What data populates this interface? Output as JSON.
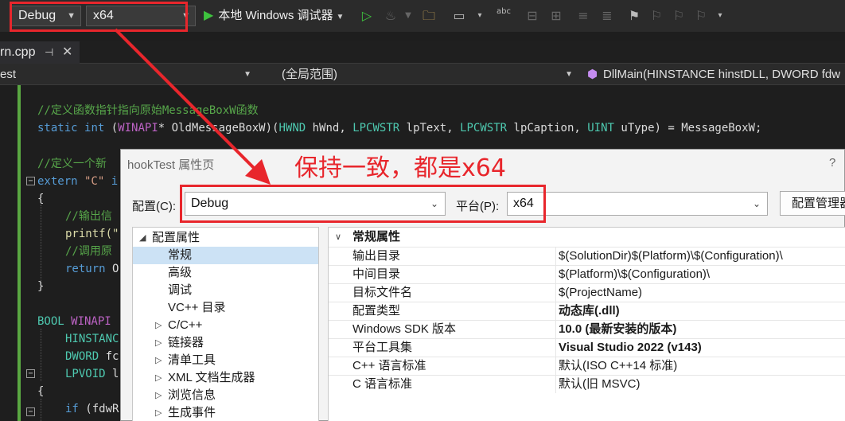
{
  "toolbar": {
    "config_value": "Debug",
    "platform_value": "x64",
    "run_label": "本地 Windows 调试器",
    "spell_icon_text": "abc"
  },
  "tabs": {
    "active_tab_label": "rn.cpp",
    "pin_glyph": "⊣",
    "close_glyph": "✕"
  },
  "navbar": {
    "project_value": "est",
    "scope_value": "(全局范围)",
    "member_value": "DllMain(HINSTANCE hinstDLL, DWORD fdw"
  },
  "code": {
    "line1_comment": "//定义函数指针指向原始MessageBoxW函数",
    "line2": {
      "kw_static": "static",
      "kw_int": "int",
      "p1": " (",
      "macro_winapi": "WINAPI",
      "p2": "* OldMessageBoxW)(",
      "t_hwnd": "HWND",
      "p3": " hWnd, ",
      "t_lpcwstr1": "LPCWSTR",
      "p4": " lpText, ",
      "t_lpcwstr2": "LPCWSTR",
      "p5": " lpCaption, ",
      "t_uint": "UINT",
      "p6": " uType) = MessageBoxW;"
    },
    "line4_comment": "//定义一个新",
    "line5": {
      "kw_extern": "extern",
      "str_c": " \"C\"",
      "rest": " i"
    },
    "line6": "{",
    "line7_comment": "//输出信",
    "line8": "printf(\"",
    "line9_comment": "//调用原",
    "line10": {
      "kw_return": "return",
      "rest": " O"
    },
    "line11": "}",
    "line13": {
      "t_bool": "BOOL",
      "macro_winapi": " WINAPI"
    },
    "line14_type": "HINSTANC",
    "line15_type": "DWORD",
    "line15_rest": " fc",
    "line16_type": "LPVOID",
    "line16_rest": " l",
    "line17": "{",
    "line18": {
      "kw_if": "if",
      "rest": " (fdwR"
    }
  },
  "dialog": {
    "title": "hookTest 属性页",
    "help": "?",
    "config_label": "配置(C):",
    "config_value": "Debug",
    "platform_label": "平台(P):",
    "platform_value": "x64",
    "manager_button": "配置管理器",
    "tree": [
      {
        "label": "配置属性",
        "expanded": true
      },
      {
        "label": "常规",
        "selected": true
      },
      {
        "label": "高级"
      },
      {
        "label": "调试"
      },
      {
        "label": "VC++ 目录"
      },
      {
        "label": "C/C++",
        "collapsed": true
      },
      {
        "label": "链接器",
        "collapsed": true
      },
      {
        "label": "清单工具",
        "collapsed": true
      },
      {
        "label": "XML 文档生成器",
        "collapsed": true
      },
      {
        "label": "浏览信息",
        "collapsed": true
      },
      {
        "label": "生成事件",
        "collapsed": true
      }
    ],
    "grid_header": "常规属性",
    "grid_rows": [
      {
        "name": "输出目录",
        "value": "$(SolutionDir)$(Platform)\\$(Configuration)\\",
        "bold": false
      },
      {
        "name": "中间目录",
        "value": "$(Platform)\\$(Configuration)\\",
        "bold": false
      },
      {
        "name": "目标文件名",
        "value": "$(ProjectName)",
        "bold": false
      },
      {
        "name": "配置类型",
        "value": "动态库(.dll)",
        "bold": true
      },
      {
        "name": "Windows SDK 版本",
        "value": "10.0 (最新安装的版本)",
        "bold": true
      },
      {
        "name": "平台工具集",
        "value": "Visual Studio 2022 (v143)",
        "bold": true
      },
      {
        "name": "C++ 语言标准",
        "value": "默认(ISO C++14 标准)",
        "bold": false
      },
      {
        "name": "C 语言标准",
        "value": "默认(旧 MSVC)",
        "bold": false
      }
    ]
  },
  "annotation": {
    "text": "保持一致，都是x64",
    "color": "#e8262c"
  },
  "colors": {
    "ide_background": "#1e1e1e",
    "toolbar_background": "#2b2b2b",
    "run_green": "#3ec23e",
    "comment_green": "#57a64a",
    "keyword_blue": "#569cd6",
    "type_teal": "#4ec9b0",
    "macro_purple": "#bd63c5",
    "dialog_background": "#f3f3f3",
    "tree_selected": "#cce2f5"
  }
}
